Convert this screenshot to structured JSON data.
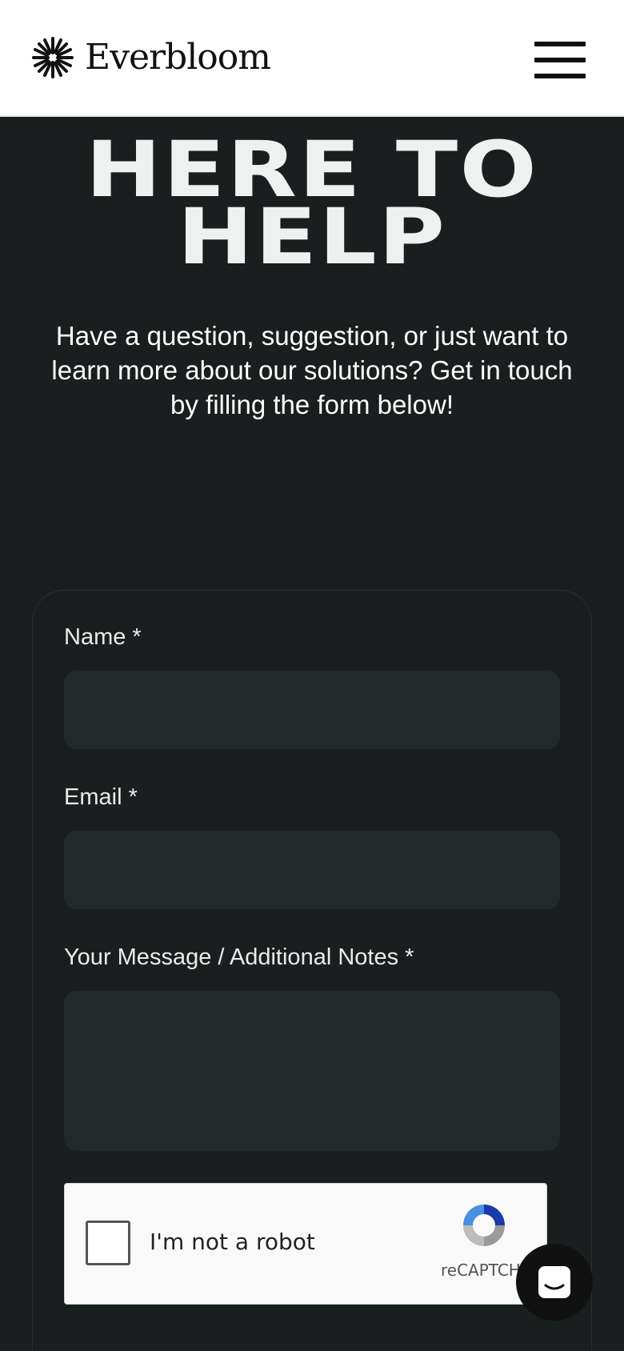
{
  "header": {
    "brand": "Everbloom"
  },
  "hero": {
    "title_line1": "HERE TO",
    "title_line2": "HELP",
    "subtitle": "Have a question, suggestion, or just want to learn more about our solutions? Get in touch by filling the form below!"
  },
  "form": {
    "name_label": "Name *",
    "email_label": "Email *",
    "message_label": "Your Message / Additional Notes *",
    "name_value": "",
    "email_value": "",
    "message_value": ""
  },
  "recaptcha": {
    "label": "I'm not a robot",
    "brand": "reCAPTCHA"
  },
  "icons": {
    "logo": "starburst-logo-icon",
    "menu": "hamburger-menu-icon",
    "chat": "chat-bubble-icon",
    "recaptcha": "recaptcha-icon"
  },
  "colors": {
    "background": "#1b1e1e",
    "field": "#232828",
    "header": "#ffffff",
    "title": "#eef1ef"
  }
}
